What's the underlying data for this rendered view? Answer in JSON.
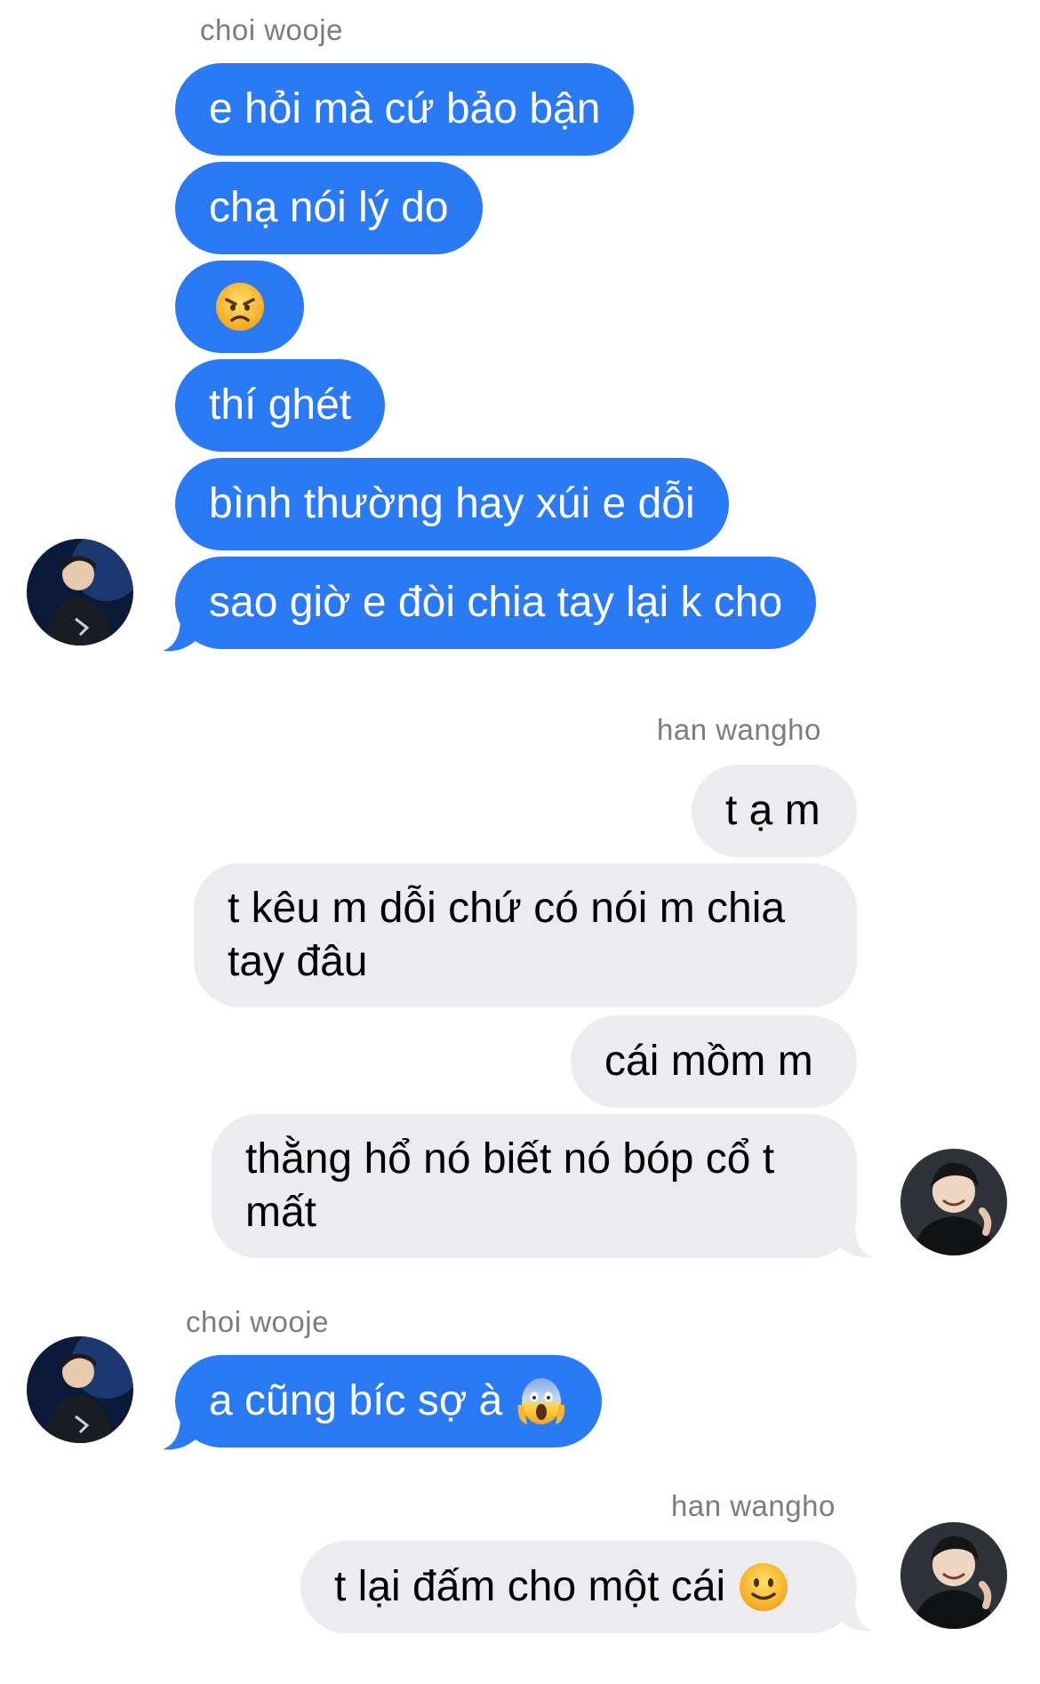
{
  "thread": {
    "sender_a_name": "choi wooje",
    "sender_b_name": "han wangho",
    "messages_a1": [
      "e hỏi mà cứ bảo bận",
      "chạ nói lý do",
      "thí ghét",
      "bình thường hay xúi e dỗi",
      "sao giờ e đòi chia tay lại k cho"
    ],
    "messages_b1": [
      "t ạ m",
      "t kêu m dỗi chứ có nói m chia tay đâu",
      "cái mồm m",
      "thằng hổ nó biết nó bóp cổ t mất"
    ],
    "messages_a2": [
      "a cũng bíc sợ à"
    ],
    "messages_b2": [
      "t lại đấm cho một cái"
    ]
  },
  "icons": {
    "angry": "angry-face-emoji",
    "scream": "face-screaming-in-fear-emoji",
    "smile": "slightly-smiling-face-emoji"
  },
  "colors": {
    "outgoing_bubble": "#2b7af5",
    "incoming_bubble": "#ececf0",
    "name_text": "#7b7b80"
  }
}
